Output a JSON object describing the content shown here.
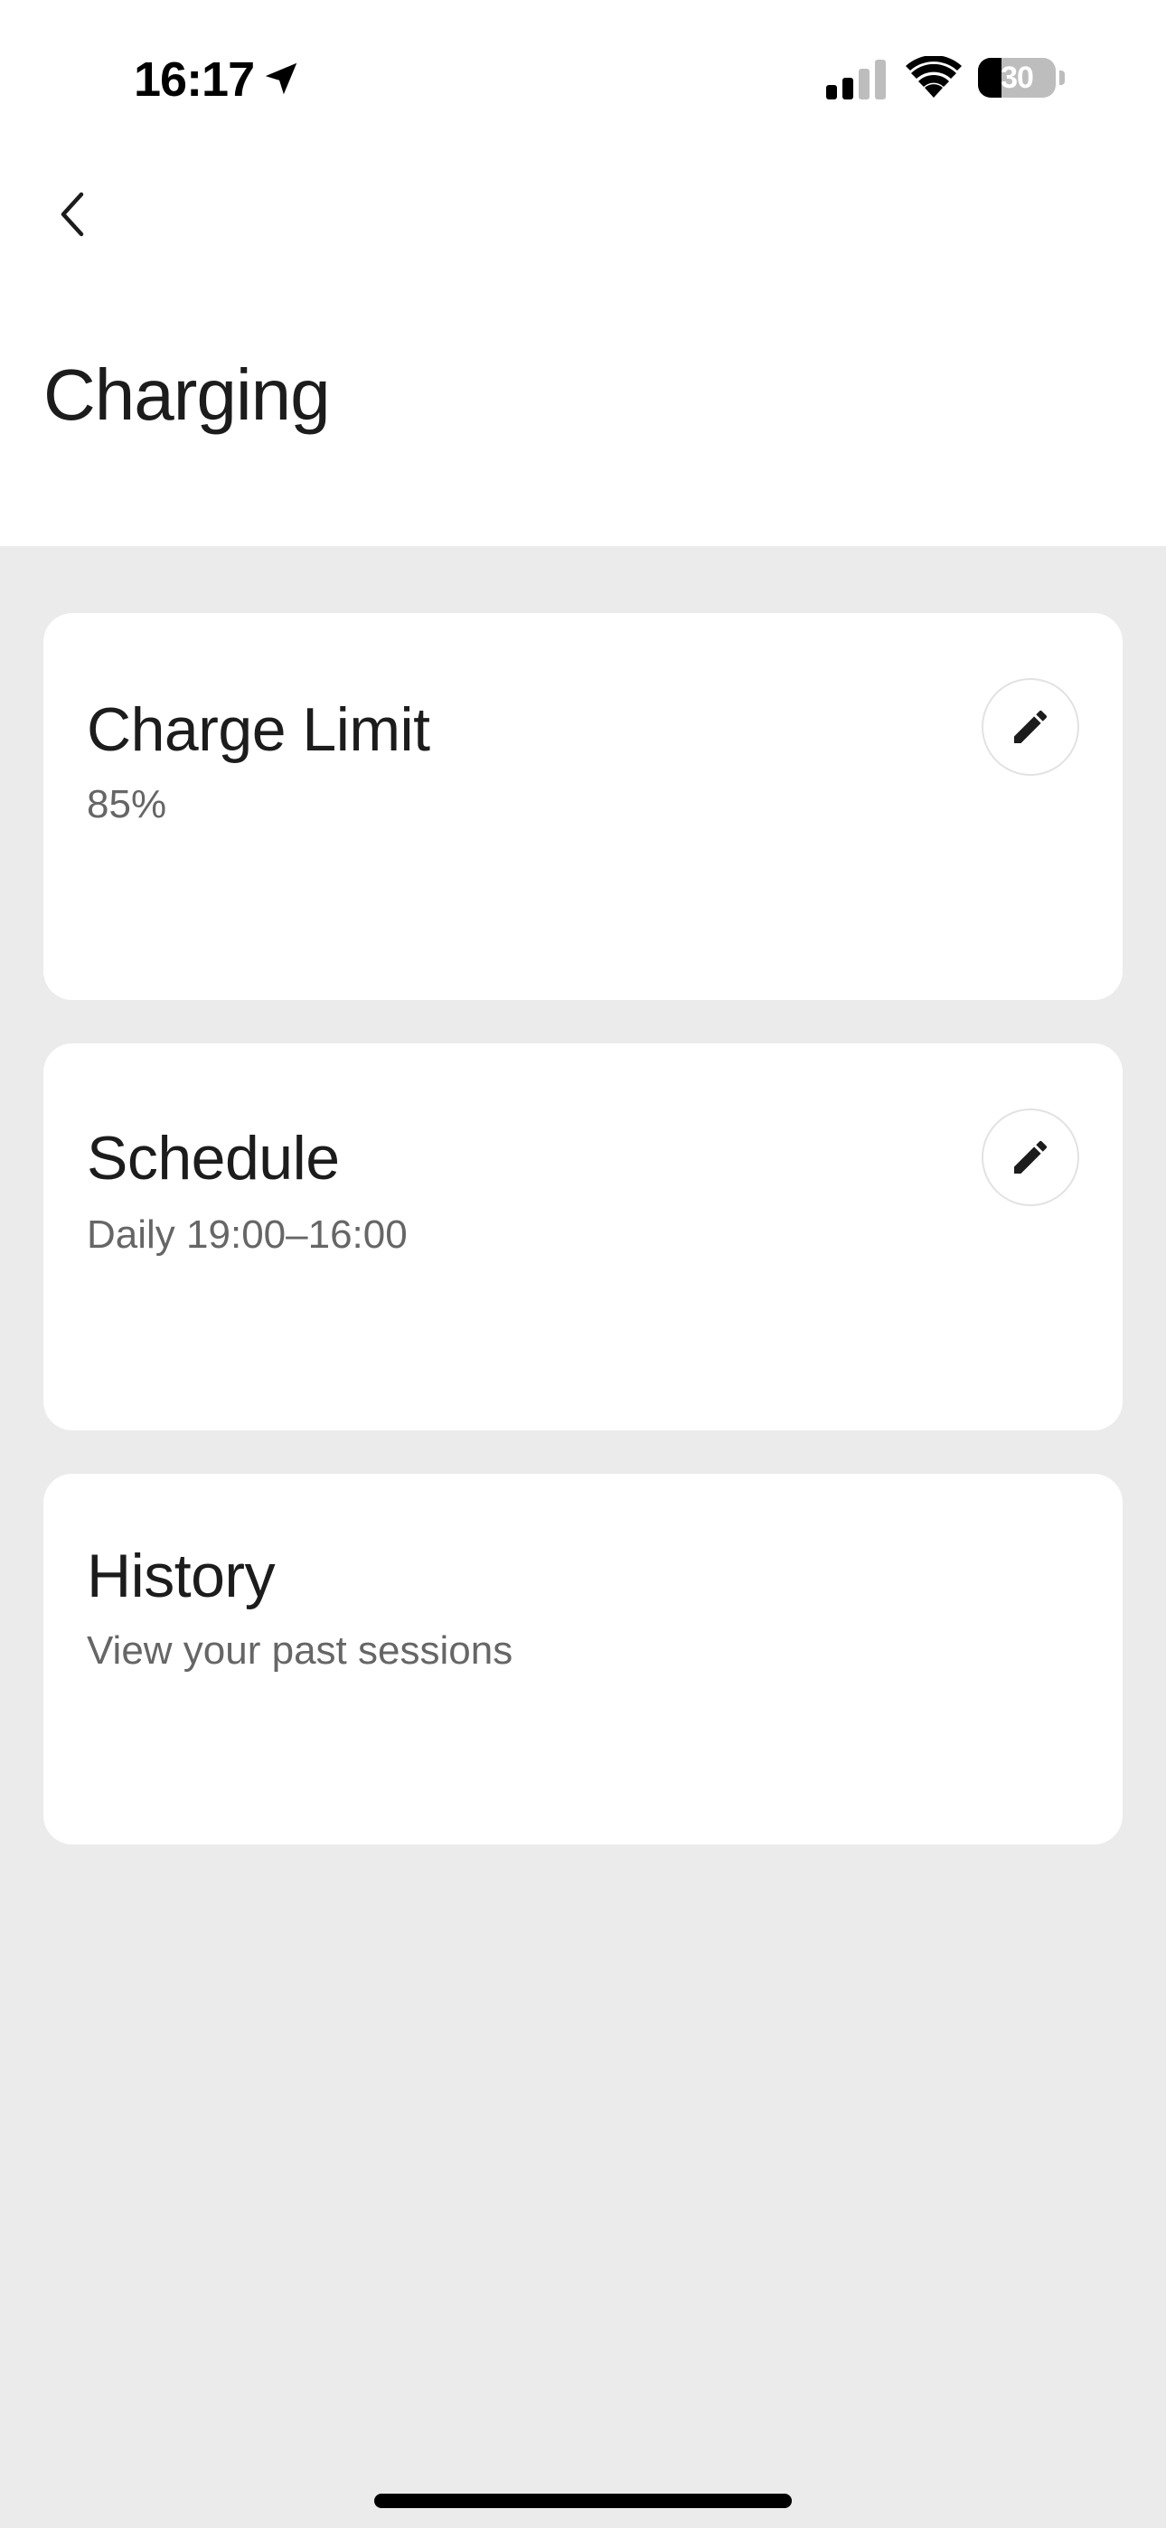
{
  "status_bar": {
    "time": "16:17",
    "battery_level": "30",
    "battery_fraction": 0.3,
    "signal_bars_active": 2,
    "signal_bars_total": 4
  },
  "header": {
    "back_icon": "chevron-left-icon",
    "title": "Charging"
  },
  "cards": {
    "charge_limit": {
      "title": "Charge Limit",
      "subtitle": "85%",
      "action_icon": "pencil-icon"
    },
    "schedule": {
      "title": "Schedule",
      "subtitle": "Daily 19:00–16:00",
      "action_icon": "pencil-icon"
    },
    "history": {
      "title": "History",
      "subtitle": "View your past sessions"
    }
  },
  "colors": {
    "background": "#ebebeb",
    "card": "#ffffff",
    "text_primary": "#1c1c1c",
    "text_secondary": "#666666"
  }
}
